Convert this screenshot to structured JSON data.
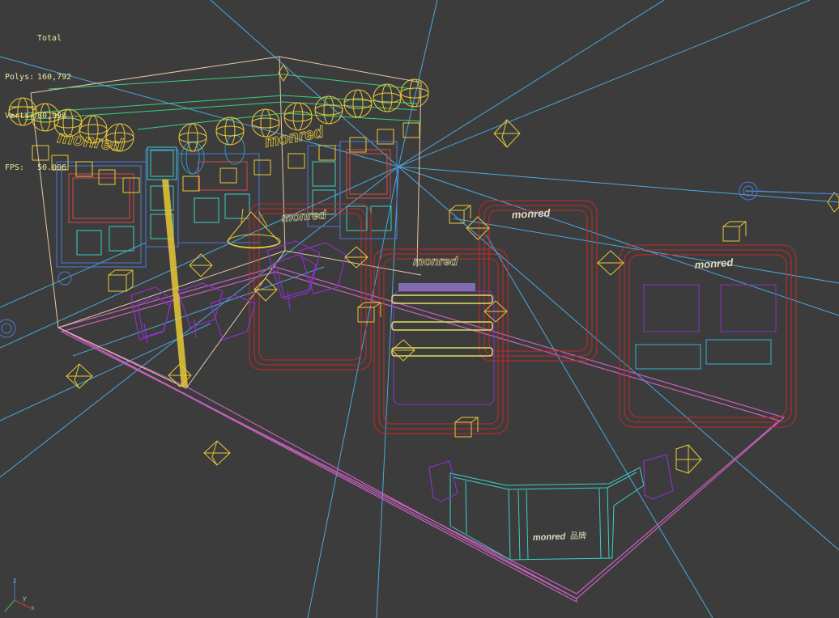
{
  "viewport": {
    "background": "#3c3c3c",
    "render_mode": "wireframe",
    "colors": {
      "light_rays": "#4aa8e0",
      "floor": "#c860c0",
      "booth_walls": "#e8c8a8",
      "lights": "#e8c838",
      "panels_red": "#c82828",
      "panels_cyan": "#3ad0c8",
      "furniture_purple": "#8a30c8",
      "shelves_yellow": "#e0e060"
    }
  },
  "stats": {
    "header": "Total",
    "polys_label": "Polys:",
    "polys_value": "160,792",
    "verts_label": "Verts:",
    "verts_value": "80,998",
    "fps_label": "FPS:",
    "fps_value": "50.006"
  },
  "brand": {
    "name": "monred",
    "chinese": "品牌"
  },
  "axis_gizmo": {
    "x": "x",
    "y": "y",
    "z": "z"
  }
}
